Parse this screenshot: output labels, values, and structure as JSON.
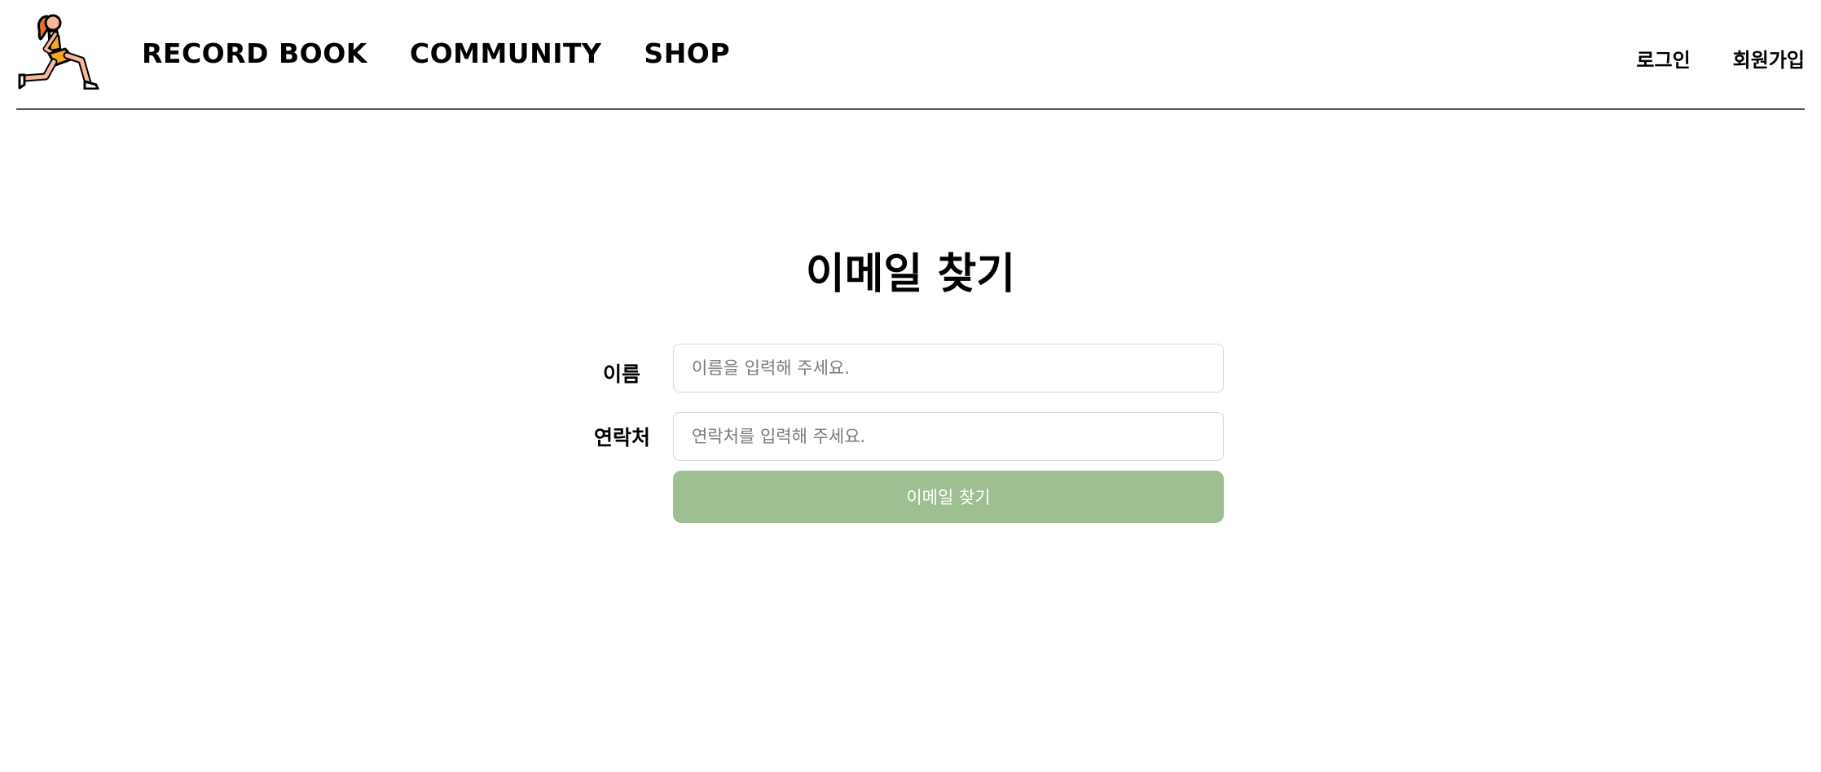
{
  "header": {
    "logo_icon": "lunging-runner-icon",
    "nav": [
      {
        "label": "RECORD BOOK"
      },
      {
        "label": "COMMUNITY"
      },
      {
        "label": "SHOP"
      }
    ],
    "auth": {
      "login_label": "로그인",
      "signup_label": "회원가입"
    }
  },
  "main": {
    "title": "이메일 찾기",
    "form": {
      "name_label": "이름",
      "name_placeholder": "이름을 입력해 주세요.",
      "name_value": "",
      "phone_label": "연락처",
      "phone_placeholder": "연락처를 입력해 주세요.",
      "phone_value": "",
      "submit_label": "이메일 찾기"
    }
  },
  "colors": {
    "accent_button": "#9dbf91",
    "skin": "#f6b99a",
    "outfit": "#f5a623",
    "hair": "#e0732f",
    "divider": "#555555"
  }
}
